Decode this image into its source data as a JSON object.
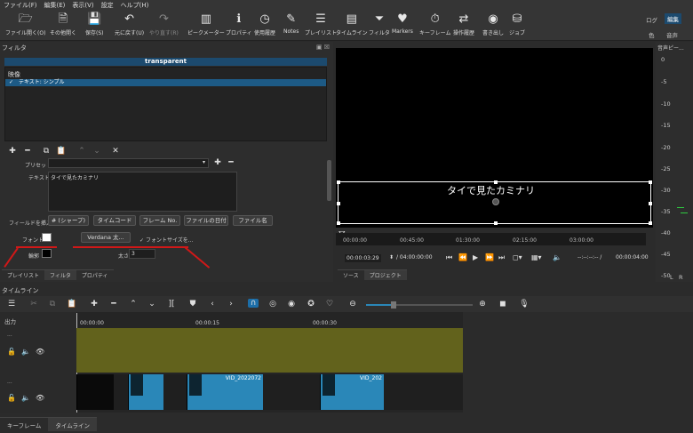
{
  "menu": [
    "ファイル(F)",
    "編集(E)",
    "表示(V)",
    "設定",
    "ヘルプ(H)"
  ],
  "toolbar": [
    {
      "icon": "folder-icon",
      "label": "ファイル開く(O)"
    },
    {
      "icon": "file-open-other-icon",
      "label": "その他開く"
    },
    {
      "icon": "save-icon",
      "label": "保存(S)"
    },
    {
      "icon": "undo-icon",
      "label": "元に戻す(U)"
    },
    {
      "icon": "redo-icon",
      "label": "やり直す(R)"
    },
    {
      "icon": "peak-meter-icon",
      "label": "ピークメーター"
    },
    {
      "icon": "properties-icon",
      "label": "プロパティ"
    },
    {
      "icon": "history-icon",
      "label": "使用履歴"
    },
    {
      "icon": "notes-icon",
      "label": "Notes"
    },
    {
      "icon": "playlist-icon",
      "label": "プレイリスト"
    },
    {
      "icon": "timeline-icon",
      "label": "タイムライン"
    },
    {
      "icon": "filter-icon",
      "label": "フィルタ"
    },
    {
      "icon": "markers-icon",
      "label": "Markers"
    },
    {
      "icon": "keyframe-icon",
      "label": "キーフレーム"
    },
    {
      "icon": "operation-history-icon",
      "label": "操作履歴"
    },
    {
      "icon": "export-icon",
      "label": "書き出し"
    },
    {
      "icon": "jobs-icon",
      "label": "ジョブ"
    }
  ],
  "layouts": {
    "log": "ログ",
    "edit": "編集",
    "color": "色",
    "audio": "音声",
    "player": "再生"
  },
  "filters_panel": {
    "title": "フィルタ",
    "filter_name": "transparent",
    "category": "映像",
    "filter_item": "テキスト: シンプル",
    "preset_label": "プリセット",
    "text_label": "テキスト",
    "text_value": "タイで見たカミナリ",
    "insert_field_label": "フィールドを挿入",
    "insert_buttons": [
      "# (シャープ)",
      "タイムコード",
      "フレーム No.",
      "ファイルの日付",
      "ファイル名"
    ],
    "font_label": "フォント",
    "font_button": "Verdana 太...",
    "font_size_check": "フォントサイズを...",
    "outline_label": "輪郭",
    "thickness_label": "太さ",
    "thickness_value": "3",
    "panel_tabs": [
      "プレイリスト",
      "フィルタ",
      "プロパティ"
    ]
  },
  "preview": {
    "overlay_text": "タイで見たカミナリ",
    "ruler_ticks": [
      "00:00:00",
      "00:45:00",
      "01:30:00",
      "02:15:00",
      "03:00:00"
    ],
    "current_time": "00:00:03:29",
    "total_time": "/ 04:00:00:00",
    "in_point": "--:--:--:-- /",
    "duration": "00:00:04:00",
    "tabs": [
      "ソース",
      "プロジェクト"
    ]
  },
  "meter": {
    "title": "音声ピー...",
    "values": [
      "0",
      "-5",
      "-10",
      "-15",
      "-20",
      "-25",
      "-30",
      "-35",
      "-40",
      "-45",
      "-50"
    ],
    "channels": [
      "L",
      "R"
    ]
  },
  "timeline": {
    "title": "タイムライン",
    "output_label": "出力",
    "ticks": [
      "00:00:00",
      "00:00:15",
      "00:00:30"
    ],
    "track_dots": "...",
    "clips": [
      "VID_2022072",
      "VID_202"
    ]
  },
  "bottom_tabs": [
    "キーフレーム",
    "タイムライン"
  ]
}
